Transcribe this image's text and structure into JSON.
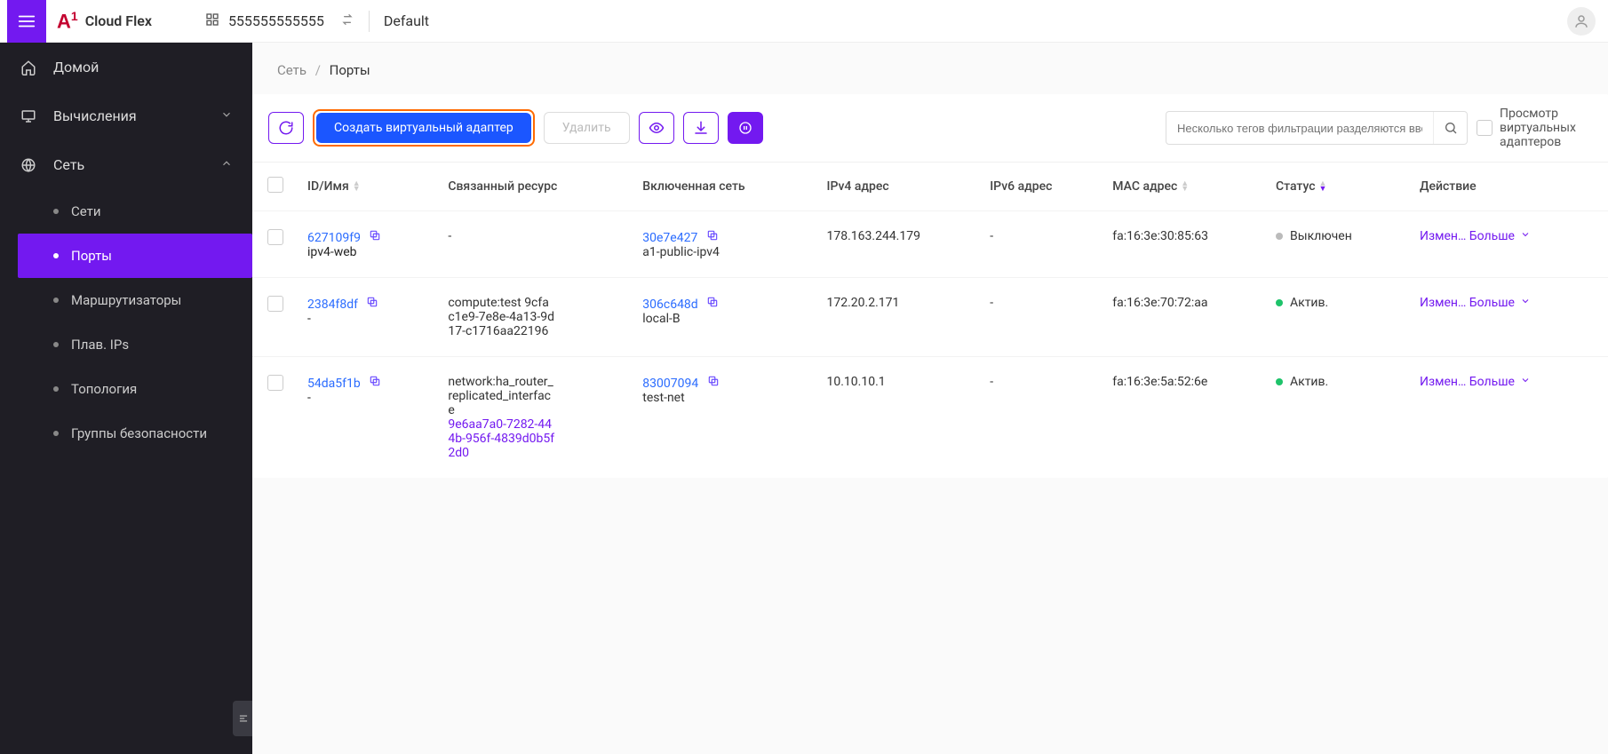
{
  "header": {
    "product": "Cloud Flex",
    "account_id": "555555555555",
    "workspace": "Default"
  },
  "sidebar": {
    "items": [
      {
        "label": "Домой"
      },
      {
        "label": "Вычисления"
      },
      {
        "label": "Сеть"
      }
    ],
    "network_children": [
      {
        "label": "Сети"
      },
      {
        "label": "Порты"
      },
      {
        "label": "Маршрутизаторы"
      },
      {
        "label": "Плав. IPs"
      },
      {
        "label": "Топология"
      },
      {
        "label": "Группы безопасности"
      }
    ]
  },
  "breadcrumb": {
    "root": "Сеть",
    "leaf": "Порты"
  },
  "toolbar": {
    "create_label": "Создать виртуальный адаптер",
    "delete_label": "Удалить",
    "search_placeholder": "Несколько тегов фильтрации разделяются вводом",
    "view_adapters_label": "Просмотр виртуальных адаптеров"
  },
  "table": {
    "headers": {
      "id_name": "ID/Имя",
      "resource": "Связанный ресурс",
      "network": "Включенная сеть",
      "ipv4": "IPv4 адрес",
      "ipv6": "IPv6 адрес",
      "mac": "MAC адрес",
      "status": "Статус",
      "action": "Действие"
    },
    "rows": [
      {
        "id": "627109f9",
        "name": "ipv4-web",
        "resource_plain": "-",
        "resource_link": "",
        "net_id": "30e7e427",
        "net_name": "a1-public-ipv4",
        "ipv4": "178.163.244.179",
        "ipv6": "-",
        "mac": "fa:16:3e:30:85:63",
        "status_label": "Выключен",
        "status_class": "grey",
        "action_edit": "Измен…",
        "action_more": "Больше"
      },
      {
        "id": "2384f8df",
        "name": "-",
        "resource_plain": "compute:test 9cfac1e9-7e8e-4a13-9d17-c1716aa22196",
        "resource_link": "",
        "net_id": "306c648d",
        "net_name": "local-B",
        "ipv4": "172.20.2.171",
        "ipv6": "-",
        "mac": "fa:16:3e:70:72:aa",
        "status_label": "Актив.",
        "status_class": "green",
        "action_edit": "Измен…",
        "action_more": "Больше"
      },
      {
        "id": "54da5f1b",
        "name": "-",
        "resource_plain": "network:ha_router_replicated_interface",
        "resource_link": "9e6aa7a0-7282-444b-956f-4839d0b5f2d0",
        "net_id": "83007094",
        "net_name": "test-net",
        "ipv4": "10.10.10.1",
        "ipv6": "-",
        "mac": "fa:16:3e:5a:52:6e",
        "status_label": "Актив.",
        "status_class": "green",
        "action_edit": "Измен…",
        "action_more": "Больше"
      }
    ]
  }
}
